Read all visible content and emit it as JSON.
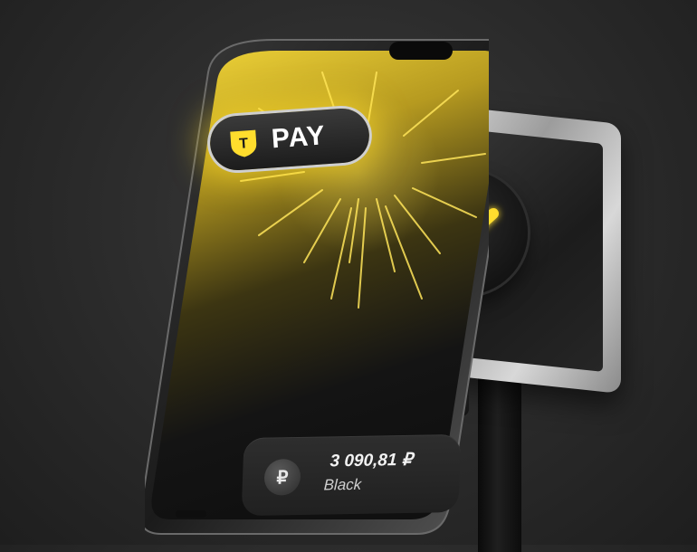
{
  "brand": {
    "logo_letter": "T",
    "pay_label": "PAY"
  },
  "payment": {
    "currency_icon": "ruble-icon",
    "currency_symbol": "₽",
    "amount": "3 090,81 ₽",
    "card_name": "Black"
  },
  "terminal": {
    "status_icon": "checkmark-icon"
  },
  "colors": {
    "accent_yellow": "#FFDD2D",
    "background": "#2A2A2A"
  }
}
